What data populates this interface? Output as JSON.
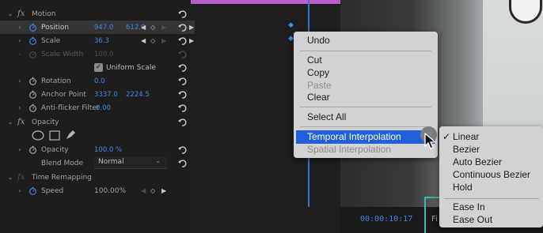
{
  "effects": {
    "motion": {
      "label": "Motion"
    },
    "position": {
      "label": "Position",
      "x": "947.0",
      "y": "612.0"
    },
    "scale": {
      "label": "Scale",
      "value": "36.3"
    },
    "scale_width": {
      "label": "Scale Width",
      "value": "100.0"
    },
    "uniform_scale": {
      "label": "Uniform Scale",
      "checked": true
    },
    "rotation": {
      "label": "Rotation",
      "value": "0.0"
    },
    "anchor_point": {
      "label": "Anchor Point",
      "x": "3337.0",
      "y": "2224.5"
    },
    "anti_flicker": {
      "label": "Anti-flicker Filter",
      "value": "0.00"
    },
    "opacity_group": {
      "label": "Opacity"
    },
    "opacity": {
      "label": "Opacity",
      "value": "100.0 %"
    },
    "blend_mode": {
      "label": "Blend Mode",
      "value": "Normal"
    },
    "time_remapping": {
      "label": "Time Remapping"
    },
    "speed": {
      "label": "Speed",
      "value": "100.00%"
    }
  },
  "timeline": {
    "timecode": "00:00:10:17",
    "fit_label": "Fi"
  },
  "context_menu": {
    "undo": "Undo",
    "cut": "Cut",
    "copy": "Copy",
    "paste": "Paste",
    "clear": "Clear",
    "select_all": "Select All",
    "temporal_interpolation": "Temporal Interpolation",
    "spatial_interpolation": "Spatial Interpolation"
  },
  "submenu": {
    "checked_item": "Linear",
    "items": [
      "Linear",
      "Bezier",
      "Auto Bezier",
      "Continuous Bezier",
      "Hold",
      "Ease In",
      "Ease Out"
    ]
  },
  "colors": {
    "value_blue": "#3f86e6",
    "menu_highlight": "#2160d8",
    "accent_teal": "#3fb6b0",
    "clip_pink": "#b95dc8"
  },
  "icons": [
    "stopwatch-icon",
    "reset-icon",
    "keyframe-icon",
    "ellipse-mask-icon",
    "rectangle-mask-icon",
    "pen-mask-icon",
    "checkmark-icon",
    "submenu-arrow-icon",
    "cursor-icon"
  ]
}
